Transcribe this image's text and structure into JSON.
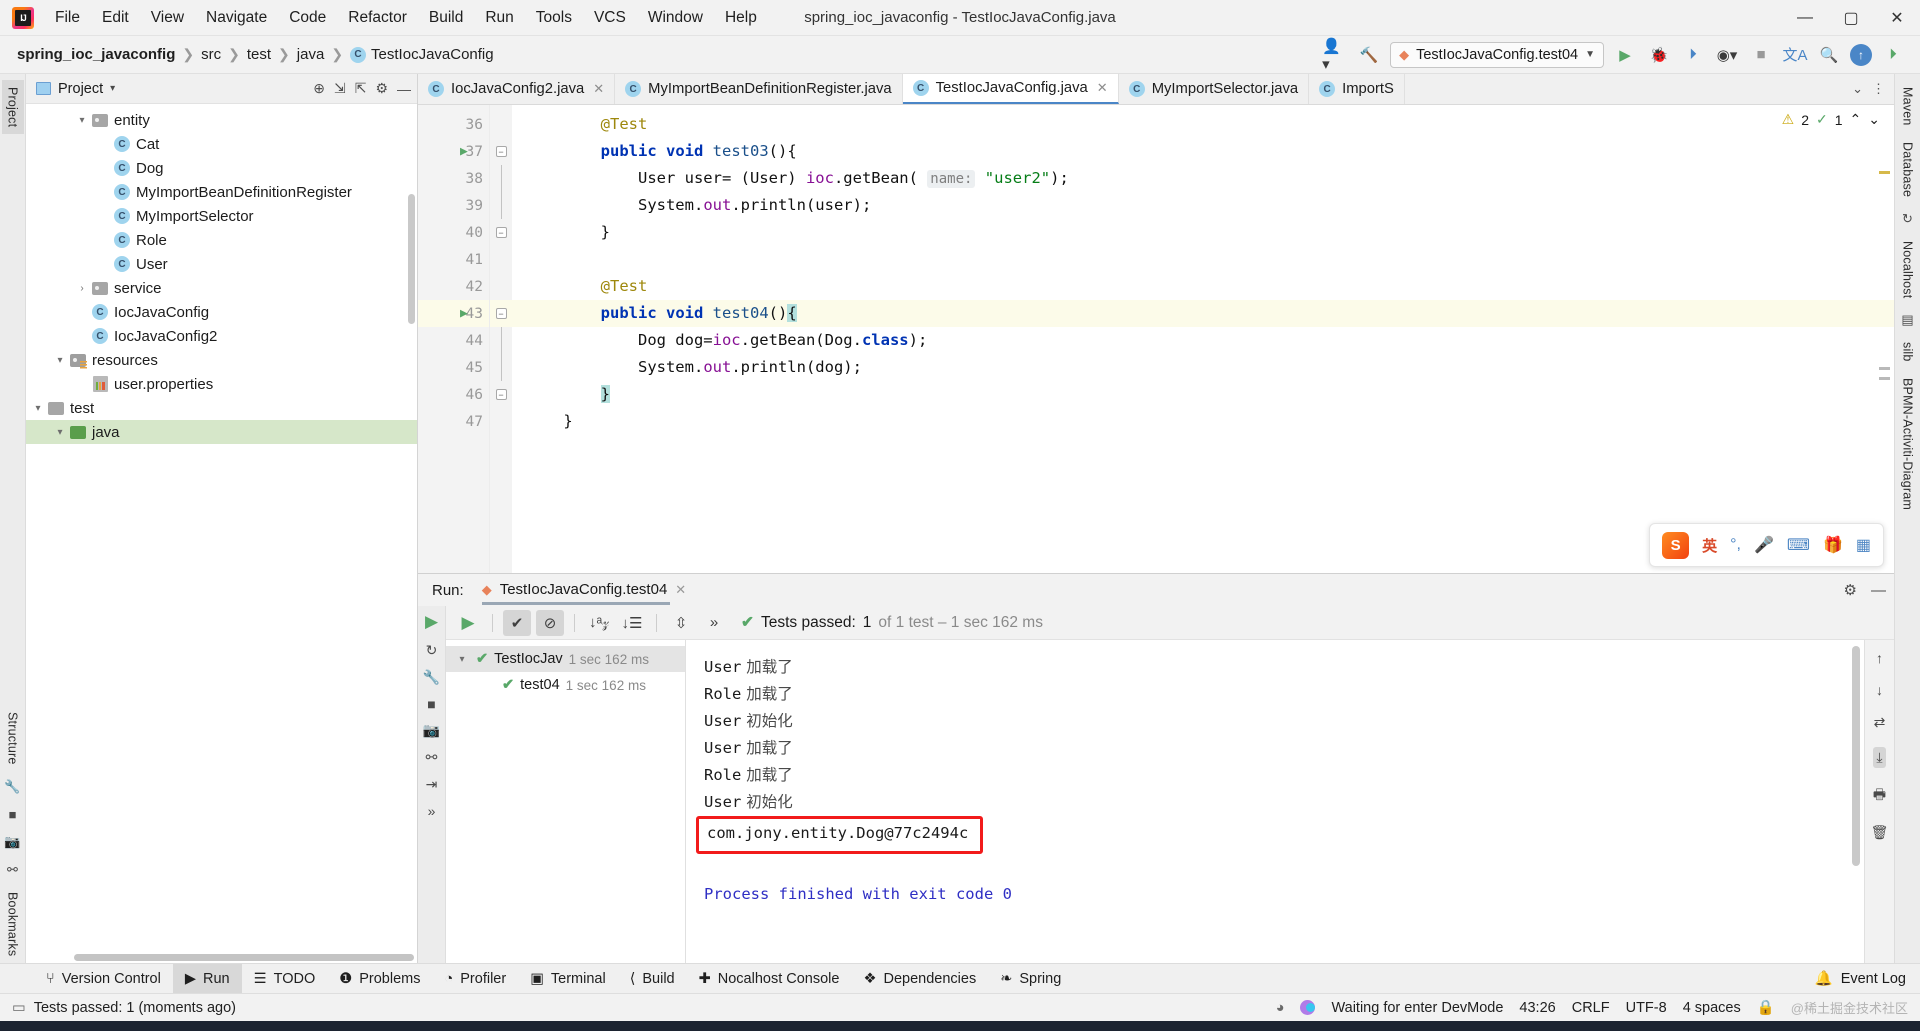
{
  "window": {
    "title": "spring_ioc_javaconfig - TestIocJavaConfig.java",
    "minimize": "—",
    "maximize": "▢",
    "close": "✕"
  },
  "menubar": [
    {
      "label": "File"
    },
    {
      "label": "Edit"
    },
    {
      "label": "View"
    },
    {
      "label": "Navigate"
    },
    {
      "label": "Code"
    },
    {
      "label": "Refactor"
    },
    {
      "label": "Build"
    },
    {
      "label": "Run"
    },
    {
      "label": "Tools"
    },
    {
      "label": "VCS"
    },
    {
      "label": "Window"
    },
    {
      "label": "Help"
    }
  ],
  "breadcrumb": {
    "sep": "❯",
    "items": [
      "spring_ioc_javaconfig",
      "src",
      "test",
      "java",
      "TestIocJavaConfig"
    ]
  },
  "toolbar": {
    "user_icon": "person-icon",
    "hammer_icon": "build-icon",
    "run_config": "TestIocJavaConfig.test04",
    "run_icon": "run-icon",
    "debug_icon": "debug-icon",
    "coverage_icon": "coverage-icon",
    "profile_icon": "profile-icon",
    "stop_icon": "stop-icon",
    "translate_icon": "translate-icon",
    "search_icon": "search-icon",
    "update_icon": "update-icon",
    "ide_icon": "ide-icon"
  },
  "left_rail": [
    {
      "label": "Project",
      "selected": true
    },
    {
      "label": "Bookmarks",
      "selected": false
    },
    {
      "label": "Structure",
      "selected": false
    }
  ],
  "right_rail": [
    {
      "label": "Maven"
    },
    {
      "label": "Database"
    },
    {
      "label": "Nocalhost"
    },
    {
      "label": "silb"
    },
    {
      "label": "BPMN-Activiti-Diagram"
    }
  ],
  "project_panel": {
    "title": "Project",
    "caret": "▾",
    "tools": [
      "target-icon",
      "expand-all-icon",
      "collapse-all-icon",
      "gear-icon",
      "hide-icon"
    ],
    "tree": [
      {
        "label": "entity",
        "indent": 2,
        "arrow": "▾",
        "icon": "folder",
        "selected": false
      },
      {
        "label": "Cat",
        "indent": 3,
        "arrow": "",
        "icon": "class",
        "selected": false
      },
      {
        "label": "Dog",
        "indent": 3,
        "arrow": "",
        "icon": "class",
        "selected": false
      },
      {
        "label": "MyImportBeanDefinitionRegister",
        "indent": 3,
        "arrow": "",
        "icon": "class",
        "selected": false
      },
      {
        "label": "MyImportSelector",
        "indent": 3,
        "arrow": "",
        "icon": "class",
        "selected": false
      },
      {
        "label": "Role",
        "indent": 3,
        "arrow": "",
        "icon": "class",
        "selected": false
      },
      {
        "label": "User",
        "indent": 3,
        "arrow": "",
        "icon": "class",
        "selected": false
      },
      {
        "label": "service",
        "indent": 2,
        "arrow": "›",
        "icon": "folder",
        "selected": false
      },
      {
        "label": "IocJavaConfig",
        "indent": 2,
        "arrow": "",
        "icon": "class",
        "selected": false
      },
      {
        "label": "IocJavaConfig2",
        "indent": 2,
        "arrow": "",
        "icon": "class",
        "selected": false
      },
      {
        "label": "resources",
        "indent": 1,
        "arrow": "▾",
        "icon": "resources",
        "selected": false
      },
      {
        "label": "user.properties",
        "indent": 2,
        "arrow": "",
        "icon": "properties",
        "selected": false
      },
      {
        "label": "test",
        "indent": 0,
        "arrow": "▾",
        "icon": "folder-plain",
        "selected": false
      },
      {
        "label": "java",
        "indent": 1,
        "arrow": "▾",
        "icon": "folder-green",
        "selected": true
      }
    ]
  },
  "editor": {
    "tabs": [
      {
        "label": "IocJavaConfig2.java",
        "active": false,
        "closable": true
      },
      {
        "label": "MyImportBeanDefinitionRegister.java",
        "active": false,
        "closable": false
      },
      {
        "label": "TestIocJavaConfig.java",
        "active": true,
        "closable": true
      },
      {
        "label": "MyImportSelector.java",
        "active": false,
        "closable": false
      },
      {
        "label": "ImportS",
        "active": false,
        "closable": false
      }
    ],
    "inspection": {
      "warnings": "2",
      "checks": "1",
      "warn_icon": "warning-icon",
      "ok_icon": "check-icon",
      "up_icon": "⌃",
      "down_icon": "⌄"
    },
    "lines": [
      {
        "num": "36",
        "current": false,
        "runnable": false,
        "fold": "",
        "tokens": [
          {
            "t": "        ",
            "c": ""
          },
          {
            "t": "@Test",
            "c": "ann"
          }
        ]
      },
      {
        "num": "37",
        "current": false,
        "runnable": true,
        "fold": "minus",
        "tokens": [
          {
            "t": "        ",
            "c": ""
          },
          {
            "t": "public",
            "c": "kw"
          },
          {
            "t": " ",
            "c": ""
          },
          {
            "t": "void",
            "c": "kw"
          },
          {
            "t": " ",
            "c": ""
          },
          {
            "t": "test03",
            "c": "mth"
          },
          {
            "t": "(){",
            "c": ""
          }
        ]
      },
      {
        "num": "38",
        "current": false,
        "runnable": false,
        "fold": "bar",
        "tokens": [
          {
            "t": "            User user= (User) ",
            "c": ""
          },
          {
            "t": "ioc",
            "c": "fld"
          },
          {
            "t": ".getBean( ",
            "c": ""
          },
          {
            "t": "name:",
            "c": "hintp"
          },
          {
            "t": " ",
            "c": ""
          },
          {
            "t": "\"user2\"",
            "c": "str"
          },
          {
            "t": ");",
            "c": ""
          }
        ]
      },
      {
        "num": "39",
        "current": false,
        "runnable": false,
        "fold": "bar",
        "tokens": [
          {
            "t": "            System.",
            "c": ""
          },
          {
            "t": "out",
            "c": "fld"
          },
          {
            "t": ".println(user);",
            "c": ""
          }
        ]
      },
      {
        "num": "40",
        "current": false,
        "runnable": false,
        "fold": "minus",
        "tokens": [
          {
            "t": "        }",
            "c": ""
          }
        ]
      },
      {
        "num": "41",
        "current": false,
        "runnable": false,
        "fold": "",
        "tokens": [
          {
            "t": "",
            "c": ""
          }
        ]
      },
      {
        "num": "42",
        "current": false,
        "runnable": false,
        "fold": "",
        "tokens": [
          {
            "t": "        ",
            "c": ""
          },
          {
            "t": "@Test",
            "c": "ann"
          }
        ]
      },
      {
        "num": "43",
        "current": true,
        "runnable": true,
        "fold": "minus",
        "tokens": [
          {
            "t": "        ",
            "c": ""
          },
          {
            "t": "public",
            "c": "kw"
          },
          {
            "t": " ",
            "c": ""
          },
          {
            "t": "void",
            "c": "kw"
          },
          {
            "t": " ",
            "c": ""
          },
          {
            "t": "test04",
            "c": "mth"
          },
          {
            "t": "()",
            "c": ""
          },
          {
            "t": "{",
            "c": "cursor-hl"
          }
        ]
      },
      {
        "num": "44",
        "current": false,
        "runnable": false,
        "fold": "bar",
        "tokens": [
          {
            "t": "            Dog dog=",
            "c": ""
          },
          {
            "t": "ioc",
            "c": "fld"
          },
          {
            "t": ".getBean(Dog.",
            "c": ""
          },
          {
            "t": "class",
            "c": "kw"
          },
          {
            "t": ");",
            "c": ""
          }
        ]
      },
      {
        "num": "45",
        "current": false,
        "runnable": false,
        "fold": "bar",
        "tokens": [
          {
            "t": "            System.",
            "c": ""
          },
          {
            "t": "out",
            "c": "fld"
          },
          {
            "t": ".println(dog);",
            "c": ""
          }
        ]
      },
      {
        "num": "46",
        "current": false,
        "runnable": false,
        "fold": "minus",
        "tokens": [
          {
            "t": "        ",
            "c": ""
          },
          {
            "t": "}",
            "c": "cursor-hl"
          }
        ]
      },
      {
        "num": "47",
        "current": false,
        "runnable": false,
        "fold": "",
        "tokens": [
          {
            "t": "    }",
            "c": ""
          }
        ]
      }
    ]
  },
  "ime_bar": {
    "logo": "S",
    "lang": "英",
    "items": [
      "punctuation-icon",
      "microphone-icon",
      "keyboard-icon",
      "gift-icon",
      "apps-icon"
    ]
  },
  "run_tool_window": {
    "label": "Run:",
    "tab": "TestIocJavaConfig.test04",
    "close": "✕",
    "settings_icon": "gear-icon",
    "hide_icon": "minimize-icon",
    "toolbar": {
      "rerun_icon": "rerun-icon",
      "passed_filter_icon": "check-icon",
      "ignored_filter_icon": "ignored-icon",
      "sort_alpha_icon": "sort-alphabetically-icon",
      "sort_duration_icon": "sort-by-duration-icon",
      "expand_icon": "expand-icon",
      "more_icon": "»",
      "status_tick": "✔",
      "status_label": "Tests passed:",
      "status_count": "1",
      "status_detail": "of 1 test – 1 sec 162 ms"
    },
    "side_icons": [
      "rerun-icon",
      "stop-icon",
      "wrench-icon",
      "stop-square-icon",
      "camera-icon",
      "thread-icon",
      "export-icon",
      "more-icon"
    ],
    "test_tree": [
      {
        "label": "TestIocJav",
        "time": "1 sec 162 ms",
        "indent": 0,
        "arrow": "▾",
        "selected": true
      },
      {
        "label": "test04",
        "time": "1 sec 162 ms",
        "indent": 1,
        "arrow": "",
        "selected": false
      }
    ],
    "console": [
      {
        "mono": "User",
        "cjk": "加载了",
        "style": "normal"
      },
      {
        "mono": "Role",
        "cjk": "加载了",
        "style": "normal"
      },
      {
        "mono": "User",
        "cjk": "初始化",
        "style": "normal"
      },
      {
        "mono": "User",
        "cjk": "加载了",
        "style": "normal"
      },
      {
        "mono": "Role",
        "cjk": "加载了",
        "style": "normal"
      },
      {
        "mono": "User",
        "cjk": "初始化",
        "style": "normal"
      },
      {
        "mono": "com.jony.entity.Dog@77c2494c",
        "cjk": "",
        "style": "boxed"
      },
      {
        "mono": "",
        "cjk": "",
        "style": "blank"
      },
      {
        "mono": "Process finished with exit code 0",
        "cjk": "",
        "style": "exit"
      }
    ],
    "right_icons": [
      "scroll-up-icon",
      "scroll-down-icon",
      "soft-wrap-icon",
      "scroll-to-end-icon",
      "print-icon",
      "trash-icon"
    ]
  },
  "tool_strip": {
    "items": [
      {
        "label": "Version Control",
        "icon": "branch-icon",
        "active": false
      },
      {
        "label": "Run",
        "icon": "run-icon",
        "active": true
      },
      {
        "label": "TODO",
        "icon": "todo-icon",
        "active": false
      },
      {
        "label": "Problems",
        "icon": "problems-icon",
        "active": false
      },
      {
        "label": "Profiler",
        "icon": "profiler-icon",
        "active": false
      },
      {
        "label": "Terminal",
        "icon": "terminal-icon",
        "active": false
      },
      {
        "label": "Build",
        "icon": "build-icon",
        "active": false
      },
      {
        "label": "Nocalhost Console",
        "icon": "nocalhost-icon",
        "active": false
      },
      {
        "label": "Dependencies",
        "icon": "dependencies-icon",
        "active": false
      },
      {
        "label": "Spring",
        "icon": "spring-icon",
        "active": false
      }
    ],
    "event_log": {
      "label": "Event Log",
      "icon": "event-log-icon"
    }
  },
  "statusbar": {
    "message_icon": "message-icon",
    "message": "Tests passed: 1 (moments ago)",
    "dev_icon": "devmode-icon",
    "dev_mode": "Waiting for enter DevMode",
    "caret": "43:26",
    "line_sep": "CRLF",
    "encoding": "UTF-8",
    "indent": "4 spaces",
    "lock_icon": "lock-icon",
    "watermark": "@稀土掘金技术社区"
  }
}
